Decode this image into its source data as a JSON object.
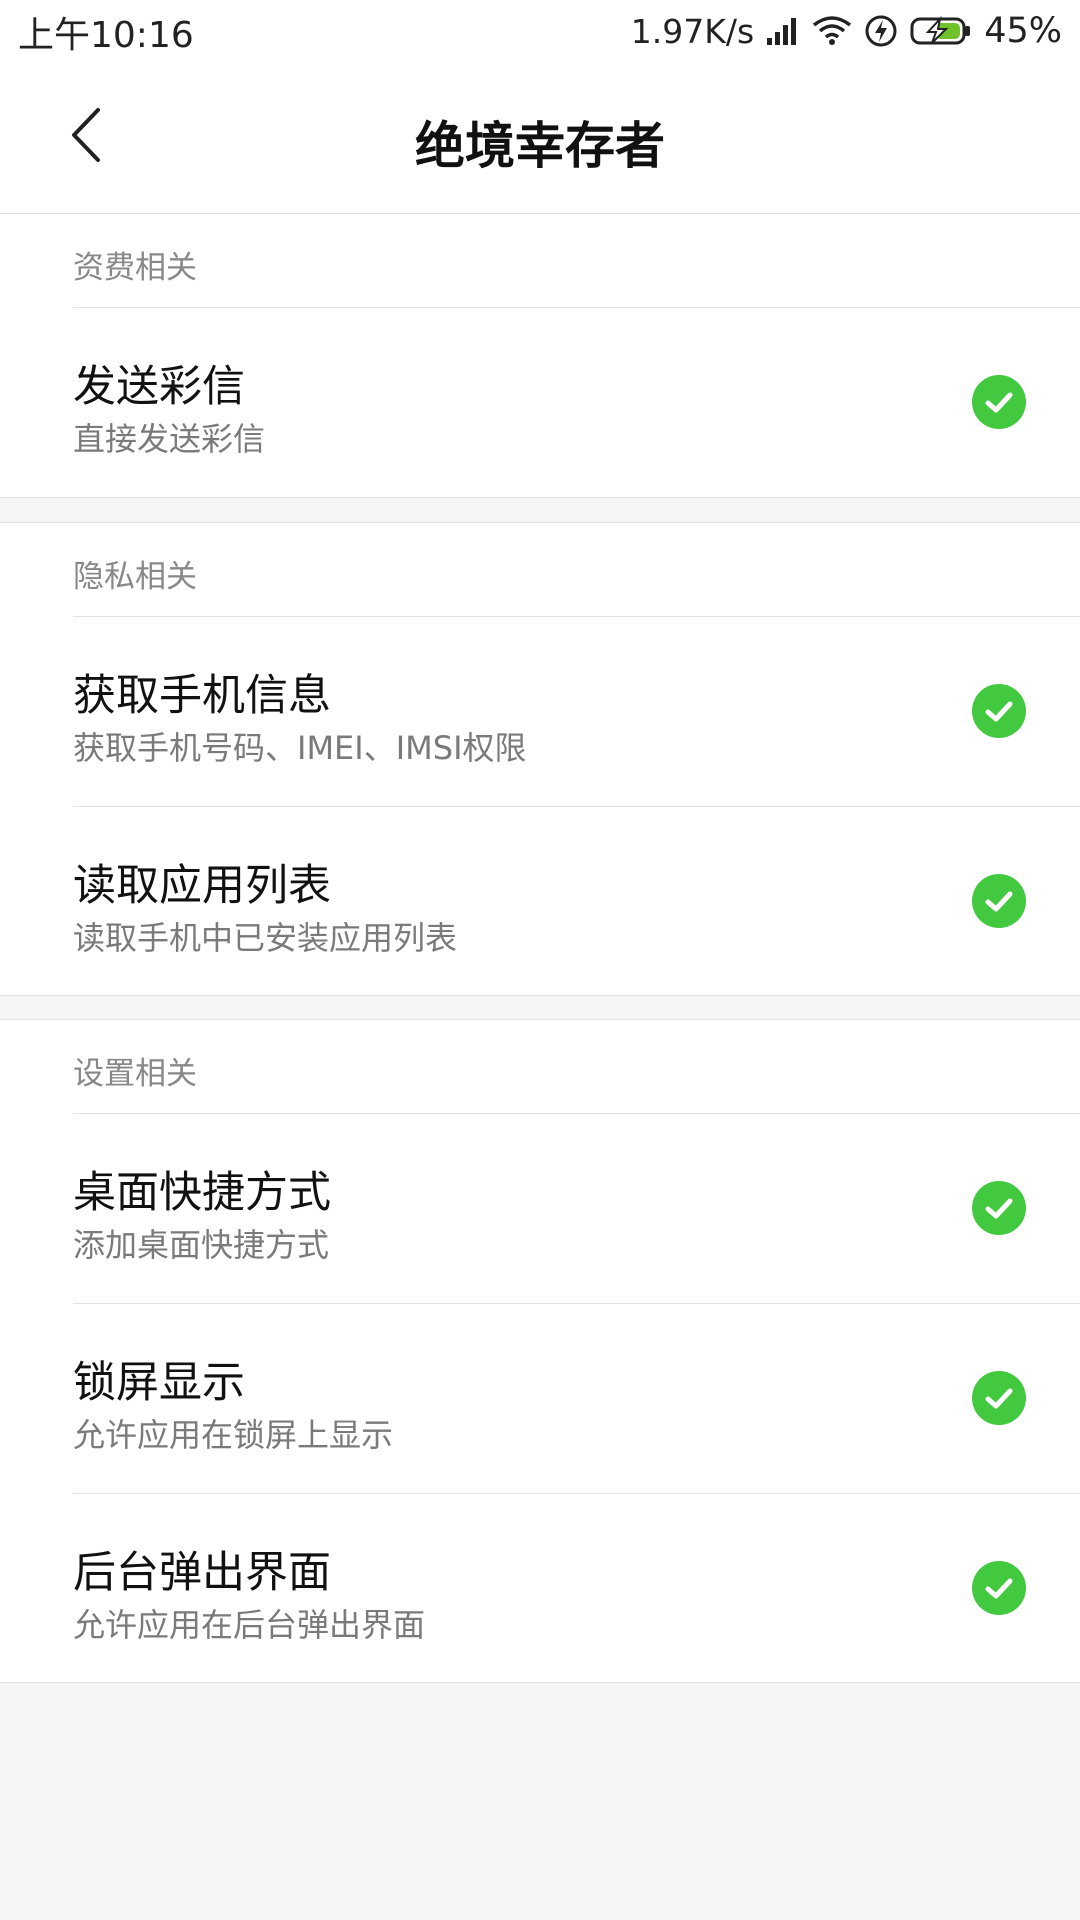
{
  "status_bar": {
    "time": "上午10:16",
    "network_speed": "1.97K/s",
    "battery_percent": "45%",
    "icons": [
      "signal-icon",
      "wifi-icon",
      "flash-icon",
      "battery-charging-icon"
    ]
  },
  "header": {
    "title": "绝境幸存者",
    "back_icon": "back-arrow-icon"
  },
  "sections": [
    {
      "header": "资费相关",
      "items": [
        {
          "title": "发送彩信",
          "subtitle": "直接发送彩信",
          "checked": true
        }
      ]
    },
    {
      "header": "隐私相关",
      "items": [
        {
          "title": "获取手机信息",
          "subtitle": "获取手机号码、IMEI、IMSI权限",
          "checked": true
        },
        {
          "title": "读取应用列表",
          "subtitle": "读取手机中已安装应用列表",
          "checked": true
        }
      ]
    },
    {
      "header": "设置相关",
      "items": [
        {
          "title": "桌面快捷方式",
          "subtitle": "添加桌面快捷方式",
          "checked": true
        },
        {
          "title": "锁屏显示",
          "subtitle": "允许应用在锁屏上显示",
          "checked": true
        },
        {
          "title": "后台弹出界面",
          "subtitle": "允许应用在后台弹出界面",
          "checked": true
        }
      ]
    }
  ],
  "colors": {
    "check_green": "#43c940",
    "background": "#f5f5f5",
    "card": "#ffffff"
  }
}
